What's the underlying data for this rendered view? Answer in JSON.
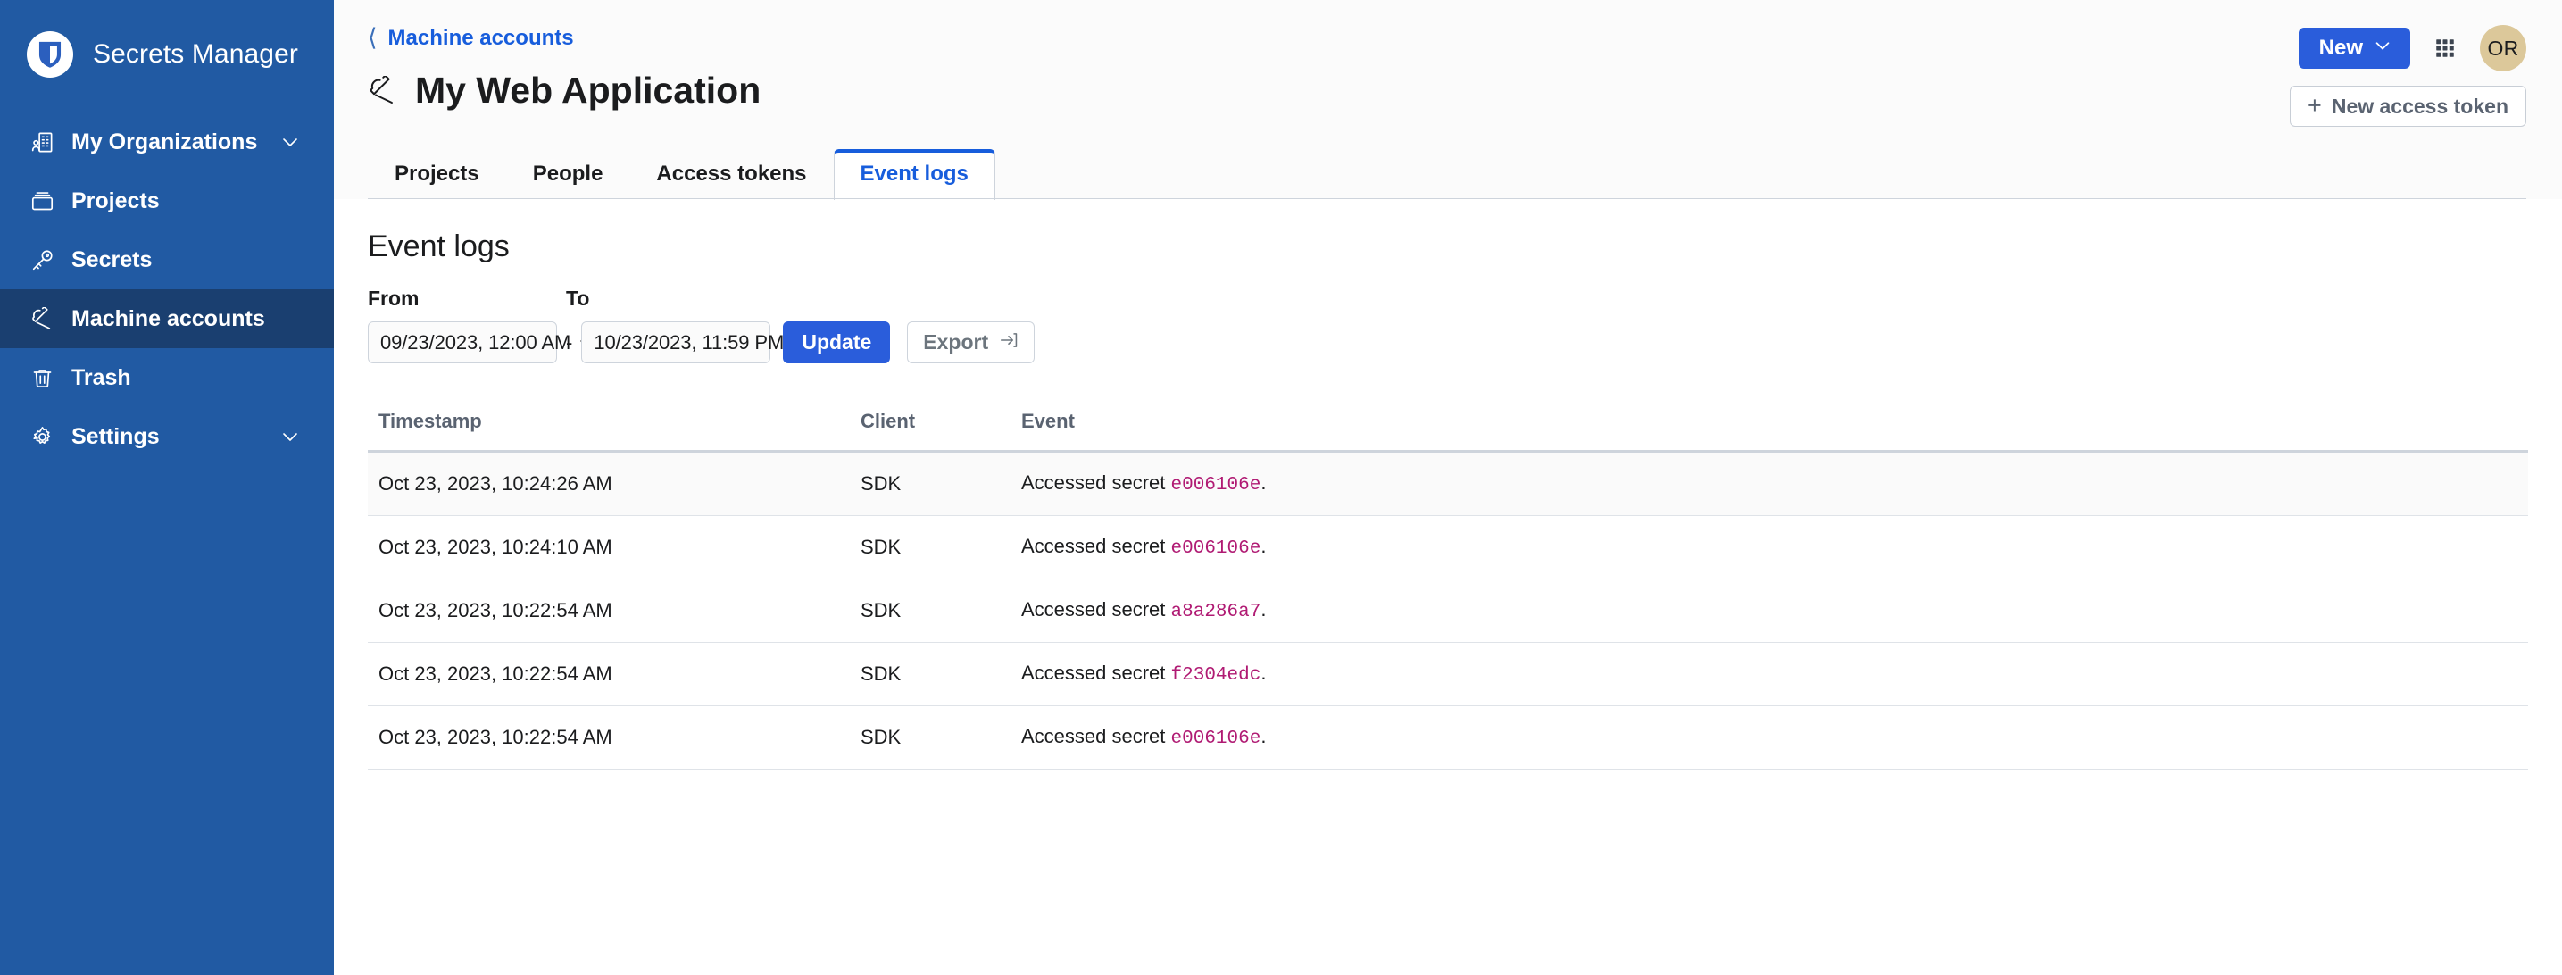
{
  "sidebar": {
    "brand": {
      "name": "Secrets Manager",
      "logo_icon": "bitwarden-shield-icon"
    },
    "items": [
      {
        "label": "My Organizations",
        "icon": "organization-icon",
        "active": false,
        "chevron": "chevron-down-icon"
      },
      {
        "label": "Projects",
        "icon": "folder-icon",
        "active": false,
        "chevron": ""
      },
      {
        "label": "Secrets",
        "icon": "key-icon",
        "active": false,
        "chevron": ""
      },
      {
        "label": "Machine accounts",
        "icon": "wrench-icon",
        "active": true,
        "chevron": ""
      },
      {
        "label": "Trash",
        "icon": "trash-icon",
        "active": false,
        "chevron": ""
      },
      {
        "label": "Settings",
        "icon": "gear-icon",
        "active": false,
        "chevron": "chevron-down-icon"
      }
    ]
  },
  "header": {
    "breadcrumb": {
      "label": "Machine accounts",
      "back_icon": "chevron-left-icon"
    },
    "title": "My Web Application",
    "title_icon": "wrench-icon",
    "new_button": {
      "label": "New",
      "chevron": "chevron-down-icon"
    },
    "apps_icon": "grid-apps-icon",
    "avatar": {
      "initials": "OR"
    },
    "new_access_token_button": {
      "label": "New access token",
      "icon": "plus-icon"
    }
  },
  "tabs": [
    {
      "label": "Projects",
      "active": false
    },
    {
      "label": "People",
      "active": false
    },
    {
      "label": "Access tokens",
      "active": false
    },
    {
      "label": "Event logs",
      "active": true
    }
  ],
  "main": {
    "section_title": "Event logs",
    "filters": {
      "from_label": "From",
      "to_label": "To",
      "from_value": "09/23/2023, 12:00 AM",
      "to_value": "10/23/2023, 11:59 PM",
      "separator": "-",
      "calendar_icon": "calendar-icon",
      "update_button": "Update",
      "export_button": "Export",
      "export_icon": "export-arrow-icon"
    },
    "table": {
      "columns": [
        "Timestamp",
        "Client",
        "Event"
      ],
      "rows": [
        {
          "timestamp": "Oct 23, 2023, 10:24:26 AM",
          "client": "SDK",
          "event_prefix": "Accessed secret ",
          "secret_id": "e006106e",
          "event_suffix": "."
        },
        {
          "timestamp": "Oct 23, 2023, 10:24:10 AM",
          "client": "SDK",
          "event_prefix": "Accessed secret ",
          "secret_id": "e006106e",
          "event_suffix": "."
        },
        {
          "timestamp": "Oct 23, 2023, 10:22:54 AM",
          "client": "SDK",
          "event_prefix": "Accessed secret ",
          "secret_id": "a8a286a7",
          "event_suffix": "."
        },
        {
          "timestamp": "Oct 23, 2023, 10:22:54 AM",
          "client": "SDK",
          "event_prefix": "Accessed secret ",
          "secret_id": "f2304edc",
          "event_suffix": "."
        },
        {
          "timestamp": "Oct 23, 2023, 10:22:54 AM",
          "client": "SDK",
          "event_prefix": "Accessed secret ",
          "secret_id": "e006106e",
          "event_suffix": "."
        }
      ]
    }
  },
  "colors": {
    "sidebar_bg": "#215aa3",
    "sidebar_active_bg": "#1a3f70",
    "primary": "#175ddc",
    "button_blue": "#2a5ddb",
    "secret_pink": "#b01a73",
    "avatar_bg": "#dcc89a",
    "text": "#1b1c1e",
    "muted": "#5a6371",
    "border": "#ced4dc"
  }
}
